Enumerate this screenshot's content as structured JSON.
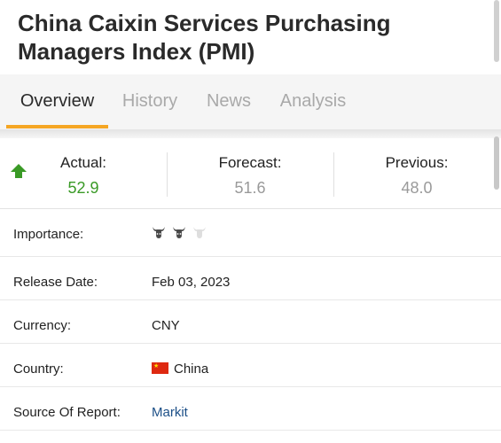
{
  "page": {
    "title": "China Caixin Services Purchasing Managers Index (PMI)"
  },
  "tabs": [
    {
      "label": "Overview",
      "active": true
    },
    {
      "label": "History",
      "active": false
    },
    {
      "label": "News",
      "active": false
    },
    {
      "label": "Analysis",
      "active": false
    }
  ],
  "stats": {
    "actual_label": "Actual:",
    "actual_value": "52.9",
    "forecast_label": "Forecast:",
    "forecast_value": "51.6",
    "previous_label": "Previous:",
    "previous_value": "48.0",
    "trend_icon": "up-arrow-icon",
    "up_color": "#3a9a26"
  },
  "details": {
    "importance_label": "Importance:",
    "importance_level": 2,
    "importance_max": 3,
    "release_date_label": "Release Date:",
    "release_date_value": "Feb 03, 2023",
    "currency_label": "Currency:",
    "currency_value": "CNY",
    "country_label": "Country:",
    "country_value": "China",
    "country_flag_icon": "china-flag-icon",
    "source_label": "Source Of Report:",
    "source_value": "Markit"
  },
  "colors": {
    "accent": "#f5a623",
    "link": "#1c4f87"
  }
}
